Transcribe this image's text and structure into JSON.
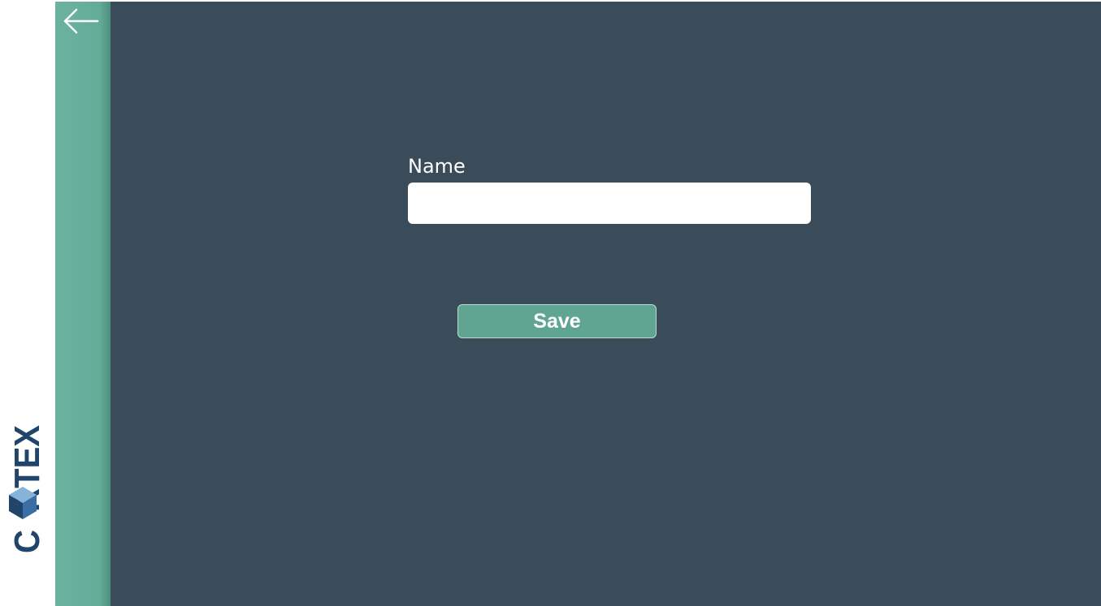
{
  "brand": {
    "logo_text": "CORTEX",
    "logo_colors": [
      "#21446b",
      "#3c6ea6",
      "#86b3d8"
    ]
  },
  "nav": {
    "back_icon": "arrow-left-icon",
    "accent_color": "#64ac98"
  },
  "form": {
    "name_label": "Name",
    "name_value": "",
    "name_placeholder": "",
    "save_label": "Save"
  },
  "colors": {
    "main_background": "#3a4b59",
    "button_background": "#5fa592"
  }
}
